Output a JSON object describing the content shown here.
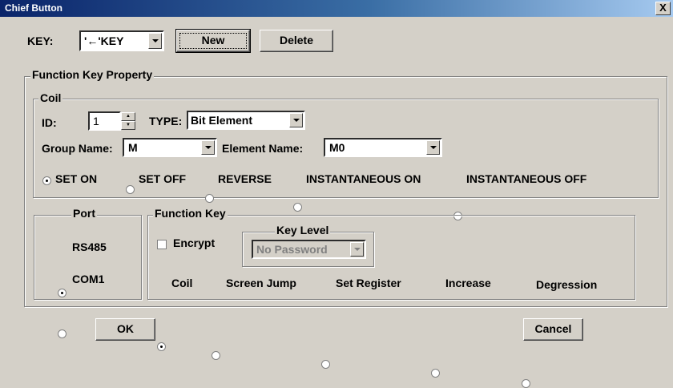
{
  "window": {
    "title": "Chief Button",
    "close_label": "X"
  },
  "key": {
    "label": "KEY:",
    "value": "'←'KEY",
    "new_label": "New",
    "delete_label": "Delete"
  },
  "fkp": {
    "legend": "Function Key Property",
    "coil": {
      "legend": "Coil",
      "id_label": "ID:",
      "id_value": "1",
      "type_label": "TYPE:",
      "type_value": "Bit Element",
      "group_label": "Group Name:",
      "group_value": "M",
      "element_label": "Element Name:",
      "element_value": "M0",
      "modes": [
        {
          "label": "SET ON",
          "selected": true
        },
        {
          "label": "SET OFF",
          "selected": false
        },
        {
          "label": "REVERSE",
          "selected": false
        },
        {
          "label": "INSTANTANEOUS ON",
          "selected": false
        },
        {
          "label": "INSTANTANEOUS OFF",
          "selected": false
        }
      ]
    },
    "port": {
      "legend": "Port",
      "options": [
        {
          "label": "RS485",
          "selected": true
        },
        {
          "label": "COM1",
          "selected": false
        }
      ]
    },
    "function_key": {
      "legend": "Function Key",
      "encrypt_label": "Encrypt",
      "encrypt_checked": false,
      "key_level_legend": "Key Level",
      "key_level_value": "No Password",
      "types": [
        {
          "label": "Coil",
          "selected": true
        },
        {
          "label": "Screen Jump",
          "selected": false
        },
        {
          "label": "Set Register",
          "selected": false
        },
        {
          "label": "Increase",
          "selected": false
        },
        {
          "label": "Degression",
          "selected": false
        }
      ]
    }
  },
  "footer": {
    "ok_label": "OK",
    "cancel_label": "Cancel"
  }
}
